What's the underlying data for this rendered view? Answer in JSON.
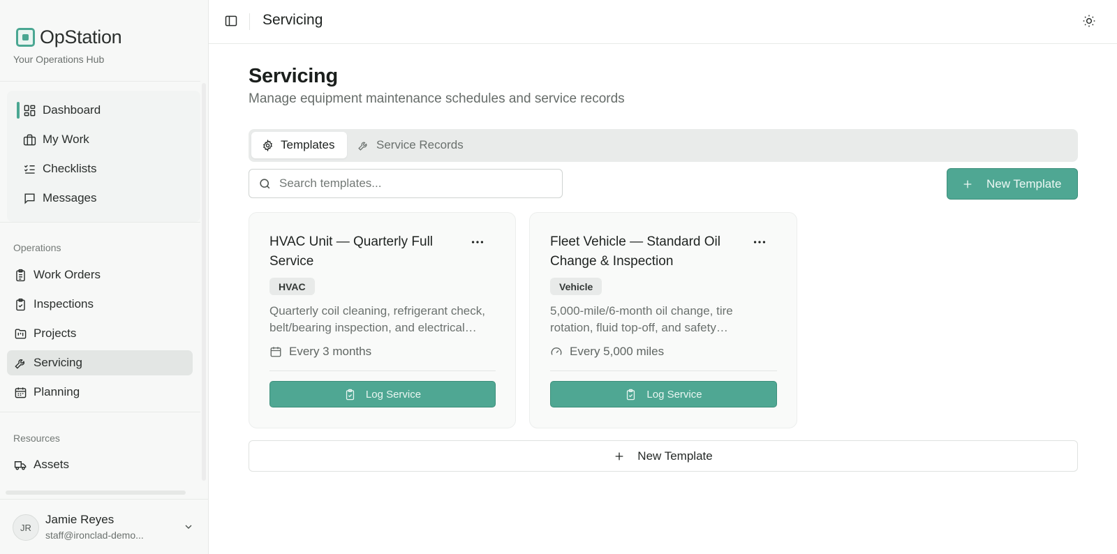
{
  "brand": {
    "name": "OpStation",
    "tagline": "Your Operations Hub"
  },
  "nav": {
    "primary": [
      {
        "label": "Dashboard",
        "icon": "dashboard-icon"
      },
      {
        "label": "My Work",
        "icon": "briefcase-icon"
      },
      {
        "label": "Checklists",
        "icon": "checklist-icon"
      },
      {
        "label": "Messages",
        "icon": "message-icon"
      }
    ],
    "operations_label": "Operations",
    "operations": [
      {
        "label": "Work Orders",
        "icon": "clipboard-list-icon"
      },
      {
        "label": "Inspections",
        "icon": "clipboard-check-icon"
      },
      {
        "label": "Projects",
        "icon": "folder-kanban-icon"
      },
      {
        "label": "Servicing",
        "icon": "wrench-icon"
      },
      {
        "label": "Planning",
        "icon": "calendar-icon"
      }
    ],
    "resources_label": "Resources",
    "resources": [
      {
        "label": "Assets",
        "icon": "truck-icon"
      }
    ],
    "active": "Servicing"
  },
  "user": {
    "initials": "JR",
    "name": "Jamie Reyes",
    "email": "staff@ironclad-demo..."
  },
  "topbar": {
    "title": "Servicing"
  },
  "page": {
    "title": "Servicing",
    "subtitle": "Manage equipment maintenance schedules and service records"
  },
  "tabs": [
    {
      "label": "Templates",
      "active": true
    },
    {
      "label": "Service Records",
      "active": false
    }
  ],
  "search": {
    "placeholder": "Search templates...",
    "value": ""
  },
  "actions": {
    "new_template": "New Template"
  },
  "cards": [
    {
      "title": "HVAC Unit — Quarterly Full Service",
      "badge": "HVAC",
      "description": "Quarterly coil cleaning, refrigerant check, belt/bearing inspection, and electrical…",
      "frequency": "Every 3 months",
      "frequency_icon": "calendar-icon",
      "action": "Log Service"
    },
    {
      "title": "Fleet Vehicle — Standard Oil Change & Inspection",
      "badge": "Vehicle",
      "description": "5,000-mile/6-month oil change, tire rotation, fluid top-off, and safety…",
      "frequency": "Every 5,000 miles",
      "frequency_icon": "gauge-icon",
      "action": "Log Service"
    }
  ],
  "footer_action": "New Template",
  "colors": {
    "accent": "#4fa793",
    "accent_border": "#3d8f7b",
    "sidebar_bg": "#f7f8f7"
  }
}
